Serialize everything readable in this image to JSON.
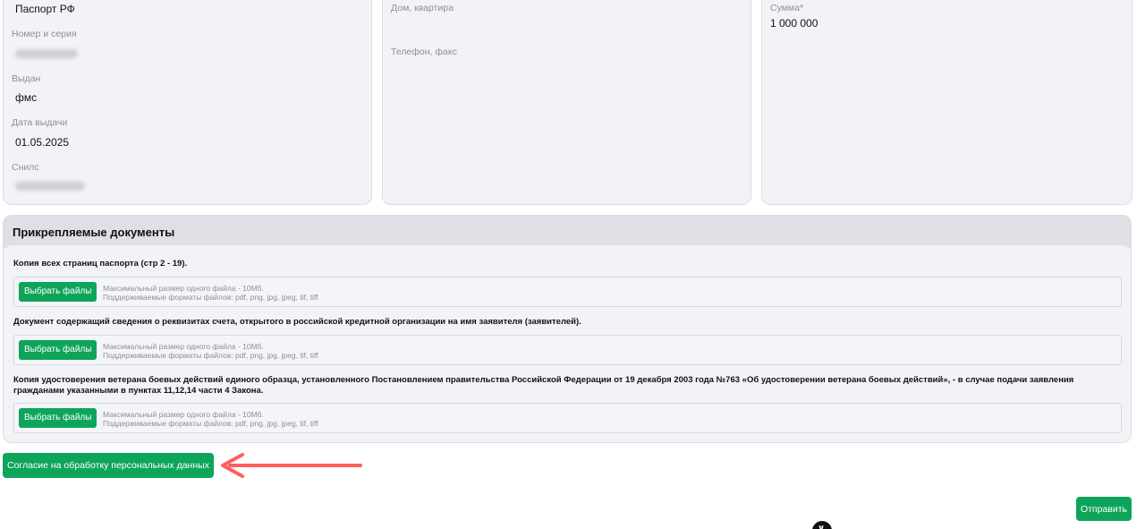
{
  "passport": {
    "doc_type": "Паспорт РФ",
    "number_label": "Номер и серия",
    "issued_label": "Выдан",
    "issued_value": "фмс",
    "date_label": "Дата выдачи",
    "date_value": "01.05.2025",
    "snils_label": "Снилс"
  },
  "address": {
    "house_label": "Дом, квартира",
    "phone_label": "Телефон, факс"
  },
  "amount": {
    "label": "Сумма*",
    "value": "1 000 000"
  },
  "documents": {
    "title": "Прикрепляемые документы",
    "items": [
      {
        "title": "Копия всех страниц паспорта (стр 2 - 19).",
        "button": "Выбрать файлы",
        "max_size": "Максимальный размер одного файла - 10Мб.",
        "formats": "Поддерживаемые форматы файлов: pdf, png, jpg, jpeg, tif, tiff"
      },
      {
        "title": "Документ содержащий сведения о реквизитах счета, открытого в российской кредитной организации на имя заявителя (заявителей).",
        "button": "Выбрать файлы",
        "max_size": "Максимальный размер одного файла - 10Мб.",
        "formats": "Поддерживаемые форматы файлов: pdf, png, jpg, jpeg, tif, tiff"
      },
      {
        "title": "Копия удостоверения ветерана боевых действий единого образца, установленного Постановлением правительства Российской Федерации от 19 декабря 2003 года №763 «Об удостоверении ветерана боевых действий», - в случае подачи заявления гражданами указанными в пунктах 11,12,14 части 4 Закона.",
        "button": "Выбрать файлы",
        "max_size": "Максимальный размер одного файла - 10Мб.",
        "formats": "Поддерживаемые форматы файлов: pdf, png, jpg, jpeg, tif, tiff"
      }
    ]
  },
  "actions": {
    "consent": "Согласие на обработку персональных данных",
    "submit": "Отправить"
  },
  "colors": {
    "accent": "#0ea55a",
    "annotation_arrow": "#ff4d4d",
    "card_bg": "#f2f3f7"
  },
  "icons": {
    "annotation": "red-arrow-icon",
    "scroll": "scroll-down-icon"
  }
}
